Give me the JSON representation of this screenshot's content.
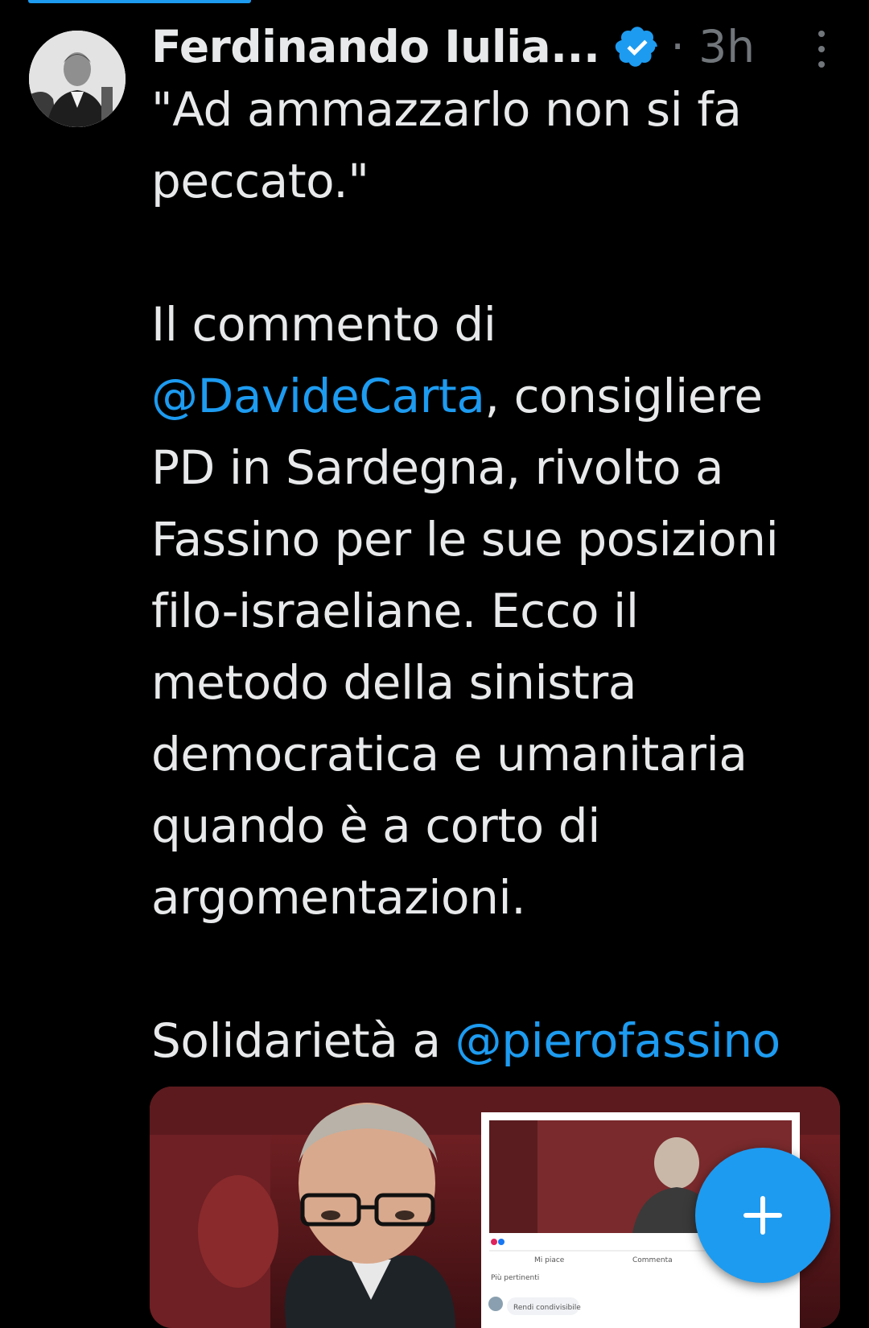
{
  "tweet": {
    "author_name": "Ferdinando Iulia...",
    "timestamp": "· 3h",
    "text_lines": [
      "\"Ad ammazzarlo non si fa",
      "peccato.\"",
      "",
      "Il commento di",
      "@DavideCarta",
      ", consigliere",
      "PD in Sardegna, rivolto a",
      "Fassino per le sue posizioni",
      "filo-israeliane. Ecco il",
      "metodo della sinistra",
      "democratica e umanitaria",
      "quando è a corto di",
      "argomentazioni.",
      "",
      "Solidarietà a ",
      "@pierofassino"
    ]
  },
  "media": {
    "facebook_like": "Mi piace",
    "facebook_comment": "Commenta",
    "facebook_sort": "Più pertinenti",
    "facebook_reply": "Rendi condivisibile"
  },
  "icons": {
    "verified": "verified-badge-icon",
    "more": "more-options-icon",
    "compose": "plus-icon"
  },
  "colors": {
    "background": "#000000",
    "text": "#e7e9ea",
    "muted": "#71767b",
    "accent": "#1d9bf0"
  }
}
